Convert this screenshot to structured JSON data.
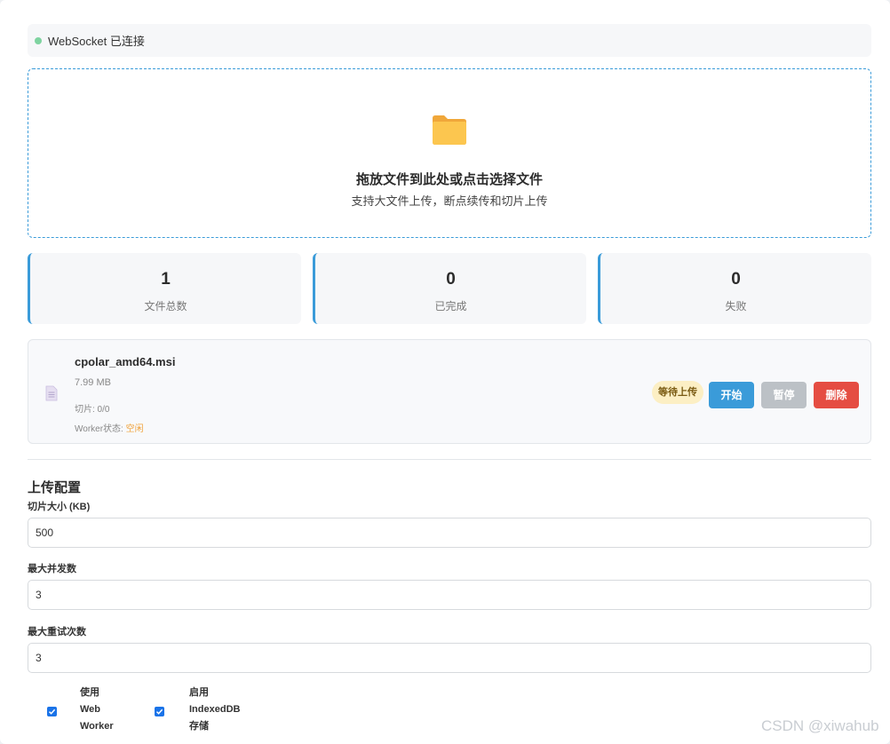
{
  "status": {
    "text": "WebSocket 已连接",
    "color": "#7ed3a0"
  },
  "dropzone": {
    "icon": "folder-icon",
    "title": "拖放文件到此处或点击选择文件",
    "subtitle": "支持大文件上传，断点续传和切片上传"
  },
  "stats": [
    {
      "value": "1",
      "label": "文件总数"
    },
    {
      "value": "0",
      "label": "已完成"
    },
    {
      "value": "0",
      "label": "失败"
    }
  ],
  "file": {
    "icon": "document-icon",
    "name": "cpolar_amd64.msi",
    "size": "7.99 MB",
    "chunks": "切片: 0/0",
    "worker_label": "Worker状态: ",
    "worker_state": "空闲",
    "badge": "等待上传",
    "start_label": "开始",
    "pause_label": "暂停",
    "delete_label": "删除"
  },
  "config": {
    "title": "上传配置",
    "chunk_size_label": "切片大小 (KB)",
    "chunk_size_value": "500",
    "max_concurrent_label": "最大并发数",
    "max_concurrent_value": "3",
    "max_retry_label": "最大重试次数",
    "max_retry_value": "3",
    "use_worker_label": "使用\nWeb\nWorker",
    "use_worker_checked": true,
    "use_indexeddb_label": "启用\nIndexedDB\n存储",
    "use_indexeddb_checked": true
  },
  "watermark": "CSDN @xiwahub",
  "colors": {
    "accent": "#3a9bd9",
    "danger": "#e54d42",
    "disabled": "#bcc1c6",
    "warning_bg": "#fcefc4"
  }
}
